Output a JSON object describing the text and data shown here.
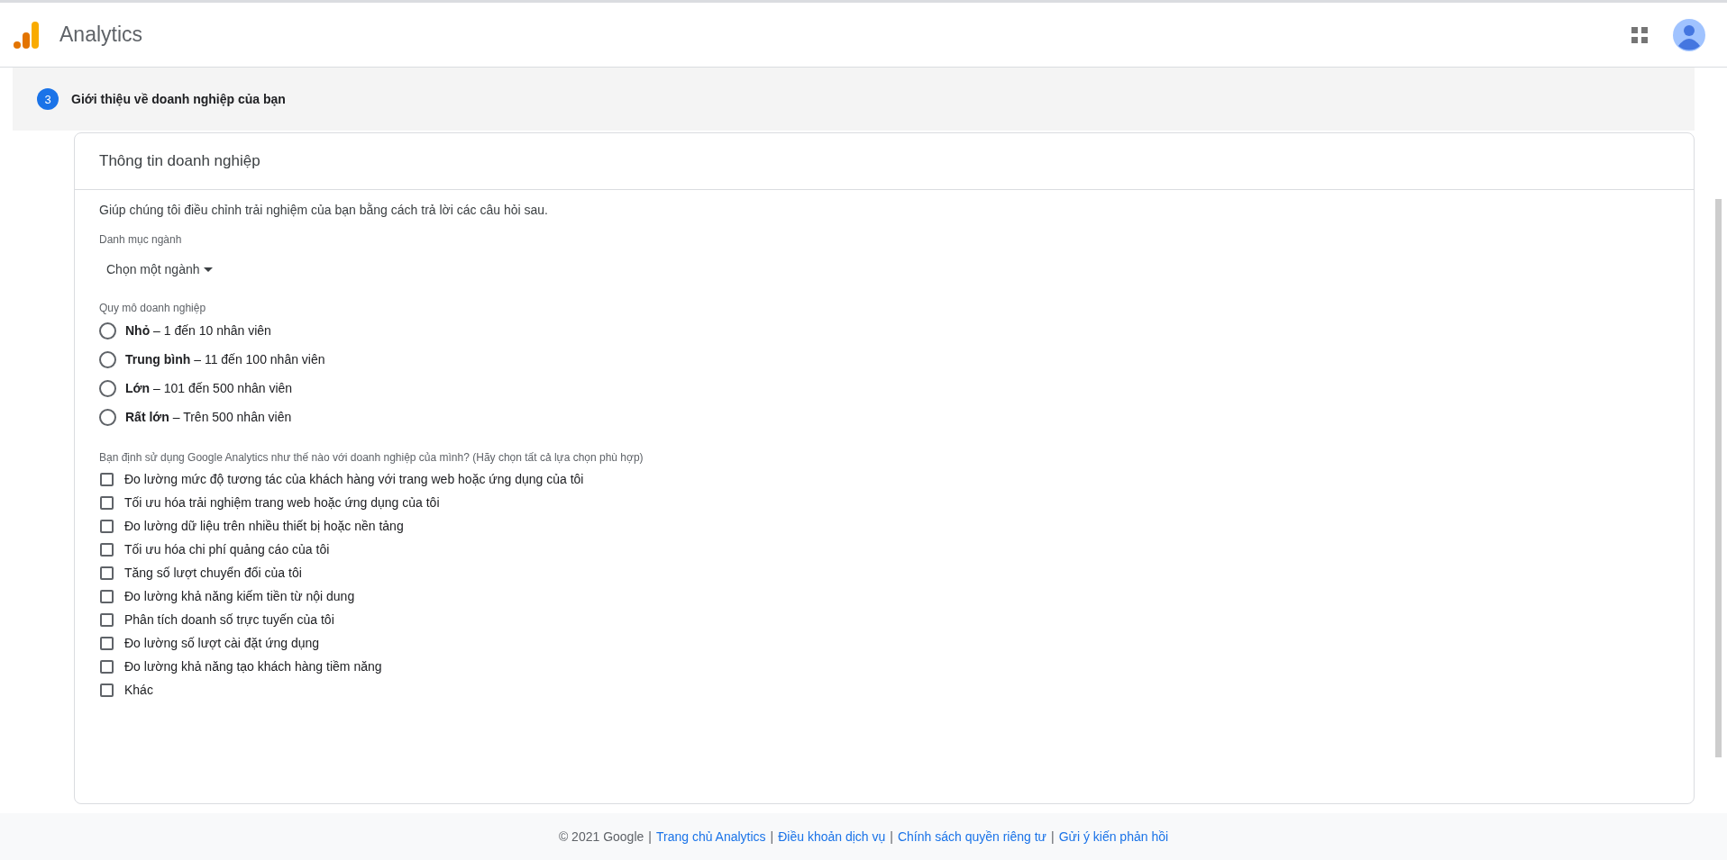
{
  "header": {
    "app_name": "Analytics"
  },
  "step": {
    "number": "3",
    "title": "Giới thiệu về doanh nghiệp của bạn"
  },
  "card": {
    "title": "Thông tin doanh nghiệp",
    "intro": "Giúp chúng tôi điều chỉnh trải nghiệm của bạn bằng cách trả lời các câu hỏi sau.",
    "industry": {
      "label": "Danh mục ngành",
      "value": "Chọn một ngành"
    },
    "size": {
      "label": "Quy mô doanh nghiệp",
      "options": [
        {
          "label": "**Nhỏ** – 1 đến 10 nhân viên",
          "selected": false
        },
        {
          "label": "**Trung bình** – 11 đến 100 nhân viên",
          "selected": false
        },
        {
          "label": "**Lớn** – 101 đến 500 nhân viên",
          "selected": false
        },
        {
          "label": "**Rất lớn** – Trên 500 nhân viên",
          "selected": false
        }
      ]
    },
    "usage": {
      "label": "Bạn định sử dụng Google Analytics như thế nào với doanh nghiệp của mình? (Hãy chọn tất cả lựa chọn phù hợp)",
      "options": [
        {
          "label": "Đo lường mức độ tương tác của khách hàng với trang web hoặc ứng dụng của tôi",
          "checked": false
        },
        {
          "label": "Tối ưu hóa trải nghiệm trang web hoặc ứng dụng của tôi",
          "checked": false
        },
        {
          "label": "Đo lường dữ liệu trên nhiều thiết bị hoặc nền tảng",
          "checked": false
        },
        {
          "label": "Tối ưu hóa chi phí quảng cáo của tôi",
          "checked": false
        },
        {
          "label": "Tăng số lượt chuyển đổi của tôi",
          "checked": false
        },
        {
          "label": "Đo lường khả năng kiếm tiền từ nội dung",
          "checked": false
        },
        {
          "label": "Phân tích doanh số trực tuyến của tôi",
          "checked": false
        },
        {
          "label": "Đo lường số lượt cài đặt ứng dụng",
          "checked": false
        },
        {
          "label": "Đo lường khả năng tạo khách hàng tiềm năng",
          "checked": false
        },
        {
          "label": "Khác",
          "checked": false
        }
      ]
    }
  },
  "footer": {
    "copyright": "© 2021 Google",
    "separator": "|",
    "links": [
      "Trang chủ Analytics",
      "Điều khoản dịch vụ",
      "Chính sách quyền riêng tư",
      "Gửi ý kiến phản hồi"
    ]
  }
}
